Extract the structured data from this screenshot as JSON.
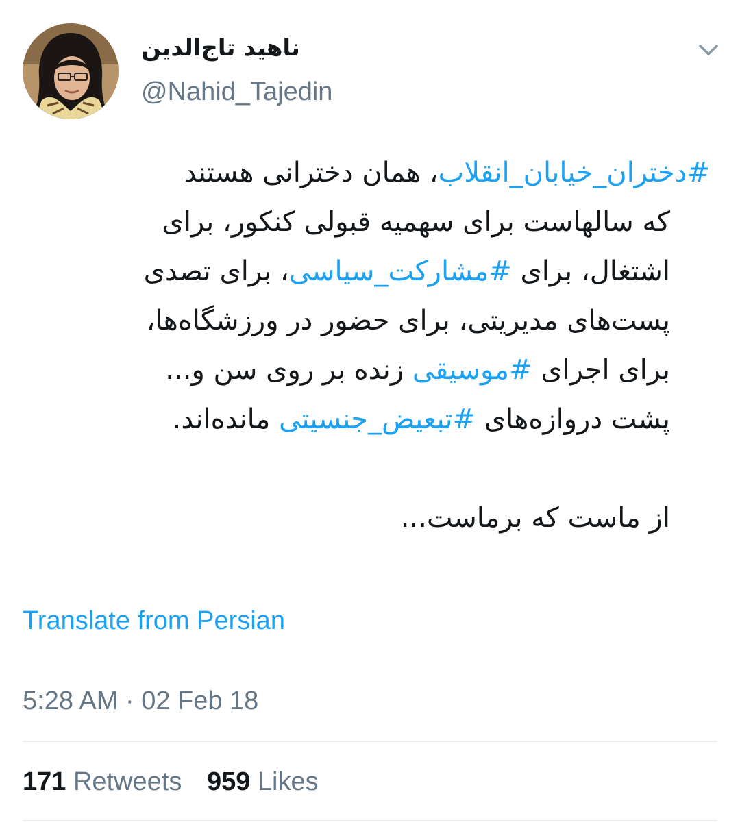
{
  "tweet": {
    "display_name": "ناهید تاج‌الدین",
    "handle": "@Nahid_Tajedin",
    "lines": [
      {
        "runs": [
          {
            "text": "#دختران_خیابان_انقلاب",
            "hashtag": true
          },
          {
            "text": "، همان دخترانی هستند",
            "hashtag": false
          }
        ]
      },
      {
        "runs": [
          {
            "text": "که سالهاست برای سهمیه قبولی  کنکور، برای",
            "hashtag": false
          }
        ]
      },
      {
        "runs": [
          {
            "text": "اشتغال، برای ",
            "hashtag": false
          },
          {
            "text": "#مشارکت_سیاسی",
            "hashtag": true
          },
          {
            "text": "، برای تصدی",
            "hashtag": false
          }
        ]
      },
      {
        "runs": [
          {
            "text": "پست‌های مدیریتی، برای حضور در ورزشگاه‌ها،",
            "hashtag": false
          }
        ]
      },
      {
        "runs": [
          {
            "text": "برای اجرای ",
            "hashtag": false
          },
          {
            "text": "#موسیقی",
            "hashtag": true
          },
          {
            "text": " زنده بر روی سن و...",
            "hashtag": false
          }
        ]
      },
      {
        "runs": [
          {
            "text": "پشت دروازه‌های ",
            "hashtag": false
          },
          {
            "text": "#تبعیض_جنسیتی",
            "hashtag": true
          },
          {
            "text": " مانده‌اند.",
            "hashtag": false
          }
        ]
      }
    ],
    "closing_line": "از ماست که برماست...",
    "translate_label": "Translate from Persian",
    "timestamp": "5:28 AM · 02 Feb 18",
    "retweets_count": "171",
    "retweets_label": "Retweets",
    "likes_count": "959",
    "likes_label": "Likes"
  },
  "colors": {
    "link": "#1da1f2",
    "secondary_text": "#657786",
    "primary_text": "#14171a",
    "divider": "#e6ecf0"
  },
  "icons": {
    "menu": "chevron-down-icon",
    "avatar": "user-avatar"
  }
}
